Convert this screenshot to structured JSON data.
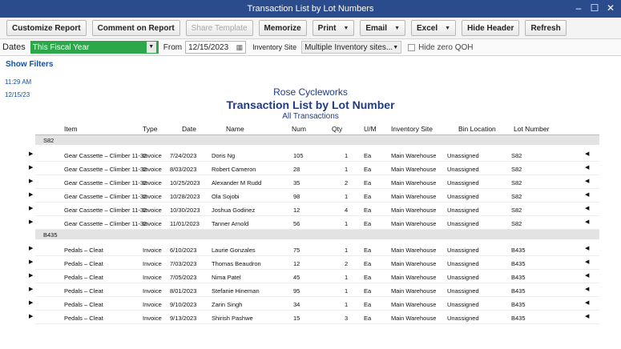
{
  "window": {
    "title": "Transaction List by Lot Numbers"
  },
  "toolbar": {
    "customize": "Customize Report",
    "comment": "Comment on Report",
    "share": "Share Template",
    "memorize": "Memorize",
    "print": "Print",
    "email": "Email",
    "excel": "Excel",
    "hide_header": "Hide Header",
    "refresh": "Refresh"
  },
  "filters": {
    "dates_label": "Dates",
    "dates_value": "This Fiscal Year",
    "from_label": "From",
    "from_value": "12/15/2023",
    "inv_site_label": "Inventory Site",
    "inv_site_value": "Multiple Inventory sites...",
    "hide_zero_qoh": "Hide zero QOH"
  },
  "show_filters": "Show Filters",
  "meta": {
    "time": "11:29 AM",
    "date": "12/15/23"
  },
  "report": {
    "company": "Rose Cycleworks",
    "title": "Transaction List by Lot Number",
    "subtitle": "All Transactions"
  },
  "columns": [
    "Item",
    "Type",
    "Date",
    "Name",
    "Num",
    "Qty",
    "U/M",
    "Inventory Site",
    "Bin Location",
    "Lot Number"
  ],
  "groups": [
    {
      "name": "S82",
      "rows": [
        {
          "item": "Gear Cassette – Climber 11-32",
          "type": "Invoice",
          "date": "7/24/2023",
          "name": "Doris Ng",
          "num": "105",
          "qty": "1",
          "um": "Ea",
          "site": "Main Warehouse",
          "bin": "Unassigned",
          "lot": "S82"
        },
        {
          "item": "Gear Cassette – Climber 11-32",
          "type": "Invoice",
          "date": "8/03/2023",
          "name": "Robert Cameron",
          "num": "28",
          "qty": "1",
          "um": "Ea",
          "site": "Main Warehouse",
          "bin": "Unassigned",
          "lot": "S82"
        },
        {
          "item": "Gear Cassette – Climber 11-32",
          "type": "Invoice",
          "date": "10/25/2023",
          "name": "Alexander M Rudd",
          "num": "35",
          "qty": "2",
          "um": "Ea",
          "site": "Main Warehouse",
          "bin": "Unassigned",
          "lot": "S82"
        },
        {
          "item": "Gear Cassette – Climber 11-32",
          "type": "Invoice",
          "date": "10/28/2023",
          "name": "Ola Sojobi",
          "num": "98",
          "qty": "1",
          "um": "Ea",
          "site": "Main Warehouse",
          "bin": "Unassigned",
          "lot": "S82"
        },
        {
          "item": "Gear Cassette – Climber 11-32",
          "type": "Invoice",
          "date": "10/30/2023",
          "name": "Joshua Godinez",
          "num": "12",
          "qty": "4",
          "um": "Ea",
          "site": "Main Warehouse",
          "bin": "Unassigned",
          "lot": "S82"
        },
        {
          "item": "Gear Cassette – Climber 11-32",
          "type": "Invoice",
          "date": "11/01/2023",
          "name": "Tanner Arnold",
          "num": "56",
          "qty": "1",
          "um": "Ea",
          "site": "Main Warehouse",
          "bin": "Unassigned",
          "lot": "S82"
        }
      ]
    },
    {
      "name": "B435",
      "rows": [
        {
          "item": "Pedals – Cleat",
          "type": "Invoice",
          "date": "6/10/2023",
          "name": "Laurie Gonzales",
          "num": "75",
          "qty": "1",
          "um": "Ea",
          "site": "Main Warehouse",
          "bin": "Unassigned",
          "lot": "B435"
        },
        {
          "item": "Pedals – Cleat",
          "type": "Invoice",
          "date": "7/03/2023",
          "name": "Thomas Beaudron",
          "num": "12",
          "qty": "2",
          "um": "Ea",
          "site": "Main Warehouse",
          "bin": "Unassigned",
          "lot": "B435"
        },
        {
          "item": "Pedals – Cleat",
          "type": "Invoice",
          "date": "7/05/2023",
          "name": "Nima Patel",
          "num": "45",
          "qty": "1",
          "um": "Ea",
          "site": "Main Warehouse",
          "bin": "Unassigned",
          "lot": "B435"
        },
        {
          "item": "Pedals – Cleat",
          "type": "Invoice",
          "date": "8/01/2023",
          "name": "Stefanie Hineman",
          "num": "95",
          "qty": "1",
          "um": "Ea",
          "site": "Main Warehouse",
          "bin": "Unassigned",
          "lot": "B435"
        },
        {
          "item": "Pedals – Cleat",
          "type": "Invoice",
          "date": "9/10/2023",
          "name": "Zarin Singh",
          "num": "34",
          "qty": "1",
          "um": "Ea",
          "site": "Main Warehouse",
          "bin": "Unassigned",
          "lot": "B435"
        },
        {
          "item": "Pedals – Cleat",
          "type": "Invoice",
          "date": "9/13/2023",
          "name": "Shirish Pashwe",
          "num": "15",
          "qty": "3",
          "um": "Ea",
          "site": "Main Warehouse",
          "bin": "Unassigned",
          "lot": "B435"
        }
      ]
    }
  ],
  "icons": {
    "expand": "expand-arrow-icon",
    "collapse": "collapse-arrow-icon",
    "calendar": "calendar-icon"
  },
  "colors": {
    "titlebar": "#2a4c8c",
    "dates_select": "#2ca84a",
    "report_header": "#1e3a8a",
    "link": "#1a4fa0"
  }
}
